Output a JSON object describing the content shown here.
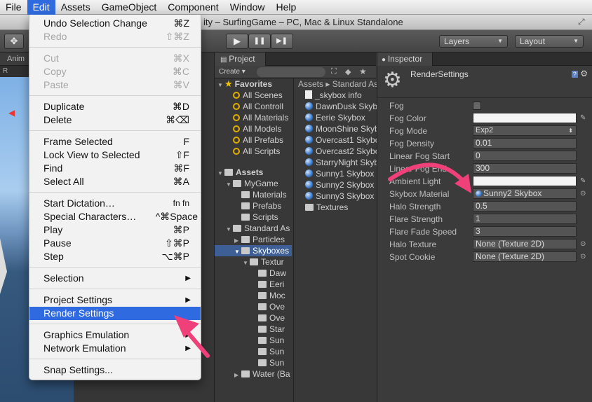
{
  "menubar": {
    "items": [
      "File",
      "Edit",
      "Assets",
      "GameObject",
      "Component",
      "Window",
      "Help"
    ],
    "active": "Edit"
  },
  "window": {
    "title": "ity – SurfingGame – PC, Mac & Linux Standalone"
  },
  "toolbar": {
    "play": "▶",
    "pause": "❚❚",
    "step": "▶❚",
    "layers": "Layers",
    "layout": "Layout"
  },
  "scene": {
    "tab": "Anim",
    "sub": "R"
  },
  "edit_menu": {
    "undo": {
      "label": "Undo Selection Change",
      "shortcut": "⌘Z"
    },
    "redo": {
      "label": "Redo",
      "shortcut": "⇧⌘Z"
    },
    "cut": {
      "label": "Cut",
      "shortcut": "⌘X"
    },
    "copy": {
      "label": "Copy",
      "shortcut": "⌘C"
    },
    "paste": {
      "label": "Paste",
      "shortcut": "⌘V"
    },
    "duplicate": {
      "label": "Duplicate",
      "shortcut": "⌘D"
    },
    "delete": {
      "label": "Delete",
      "shortcut": "⌘⌫"
    },
    "frame_selected": {
      "label": "Frame Selected",
      "shortcut": "F"
    },
    "lock_view": {
      "label": "Lock View to Selected",
      "shortcut": "⇧F"
    },
    "find": {
      "label": "Find",
      "shortcut": "⌘F"
    },
    "select_all": {
      "label": "Select All",
      "shortcut": "⌘A"
    },
    "start_dictation": {
      "label": "Start Dictation…",
      "shortcut": "fn fn"
    },
    "special_chars": {
      "label": "Special Characters…",
      "shortcut": "^⌘Space"
    },
    "play": {
      "label": "Play",
      "shortcut": "⌘P"
    },
    "pause": {
      "label": "Pause",
      "shortcut": "⇧⌘P"
    },
    "step": {
      "label": "Step",
      "shortcut": "⌥⌘P"
    },
    "selection": {
      "label": "Selection"
    },
    "project_settings": {
      "label": "Project Settings"
    },
    "render_settings": {
      "label": "Render Settings"
    },
    "graphics_emulation": {
      "label": "Graphics Emulation"
    },
    "network_emulation": {
      "label": "Network Emulation"
    },
    "snap_settings": {
      "label": "Snap Settings..."
    }
  },
  "project": {
    "tab": "Project",
    "create": "Create ▾",
    "tree": {
      "favorites": "Favorites",
      "fav_items": [
        "All Scenes",
        "All Controll",
        "All Materials",
        "All Models",
        "All Prefabs",
        "All Scripts"
      ],
      "assets": "Assets",
      "mygame": "MyGame",
      "mygame_children": [
        "Materials",
        "Prefabs",
        "Scripts"
      ],
      "standard": "Standard As",
      "particles": "Particles",
      "skyboxes": "Skyboxes",
      "textures": "Textur",
      "texture_children": [
        "Daw",
        "Eeri",
        "Moc",
        "Ove",
        "Ove",
        "Star",
        "Sun",
        "Sun",
        "Sun"
      ],
      "water": "Water (Ba"
    },
    "breadcrumb": "Assets ▸ Standard As",
    "files": [
      "_skybox info",
      "DawnDusk Skybo",
      "Eerie Skybox",
      "MoonShine Skyb",
      "Overcast1 Skybo",
      "Overcast2 Skybo",
      "StarryNight Skyb",
      "Sunny1 Skybox",
      "Sunny2 Skybox",
      "Sunny3 Skybox",
      "Textures"
    ]
  },
  "inspector": {
    "tab": "Inspector",
    "title": "RenderSettings",
    "props": {
      "fog": "Fog",
      "fog_color": "Fog Color",
      "fog_mode": "Fog Mode",
      "fog_mode_value": "Exp2",
      "fog_density": "Fog Density",
      "fog_density_value": "0.01",
      "linear_start": "Linear Fog Start",
      "linear_start_value": "0",
      "linear_end": "Linear Fog End",
      "linear_end_value": "300",
      "ambient": "Ambient Light",
      "skybox": "Skybox Material",
      "skybox_value": "Sunny2 Skybox",
      "halo_strength": "Halo Strength",
      "halo_strength_value": "0.5",
      "flare_strength": "Flare Strength",
      "flare_strength_value": "1",
      "flare_fade": "Flare Fade Speed",
      "flare_fade_value": "3",
      "halo_texture": "Halo Texture",
      "halo_texture_value": "None (Texture 2D)",
      "spot_cookie": "Spot Cookie",
      "spot_cookie_value": "None (Texture 2D)"
    }
  },
  "colors": {
    "accent": "#2f6ae0",
    "annotation": "#f0407a"
  }
}
